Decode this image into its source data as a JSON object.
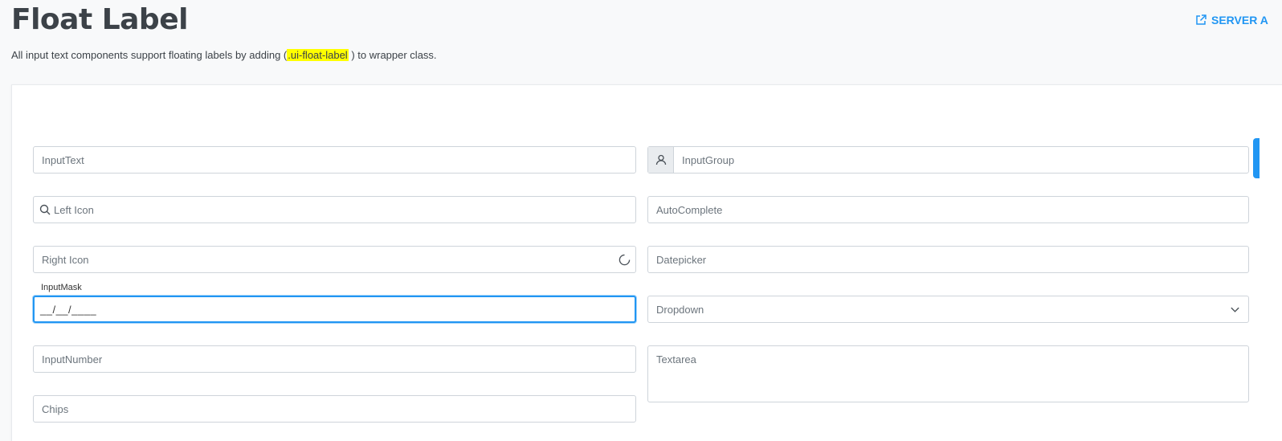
{
  "header": {
    "title": "Float Label",
    "server_link": "SERVER A"
  },
  "description": {
    "before": "All input text components support floating labels by adding (",
    "highlight": ".ui-float-label",
    "after": ") to wrapper class."
  },
  "form": {
    "inputtext": "InputText",
    "inputgroup": "InputGroup",
    "left_icon": "Left Icon",
    "autocomplete": "AutoComplete",
    "right_icon": "Right Icon",
    "datepicker": "Datepicker",
    "inputmask_label": "InputMask",
    "inputmask_value": "__/__/____",
    "dropdown": "Dropdown",
    "inputnumber": "InputNumber",
    "textarea": "Textarea",
    "chips": "Chips"
  },
  "colors": {
    "accent": "#2196f3",
    "highlight": "#ffff00",
    "border": "#ced4da"
  },
  "icons": {
    "server_link": "external-link-icon",
    "inputgroup": "user-icon",
    "left": "search-icon",
    "right": "spinner-icon",
    "dropdown": "chevron-down-icon"
  }
}
